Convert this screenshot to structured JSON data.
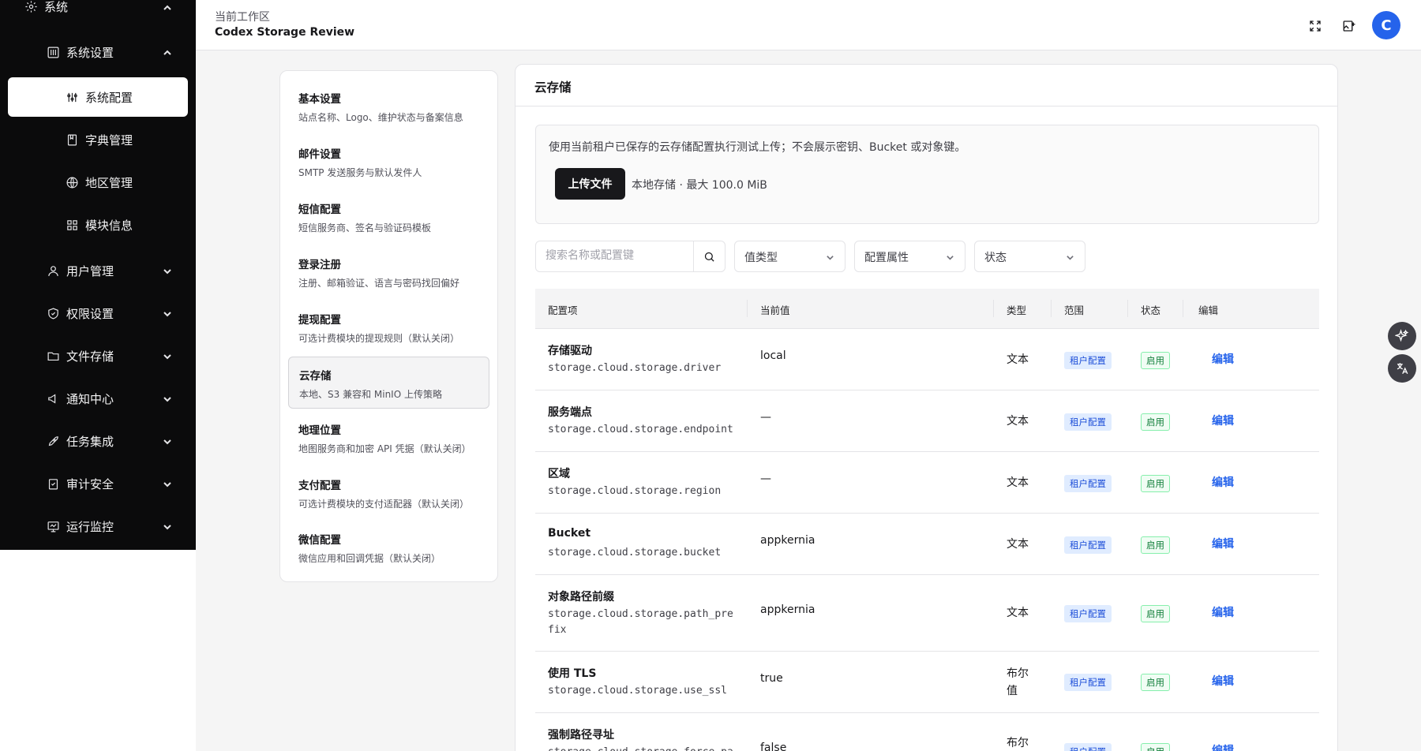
{
  "sidebar": {
    "section_title": "系统",
    "group_title": "系统设置",
    "items": [
      {
        "label": "系统配置"
      },
      {
        "label": "字典管理"
      },
      {
        "label": "地区管理"
      },
      {
        "label": "模块信息"
      }
    ],
    "sections": [
      {
        "label": "用户管理"
      },
      {
        "label": "权限设置"
      },
      {
        "label": "文件存储"
      },
      {
        "label": "通知中心"
      },
      {
        "label": "任务集成"
      },
      {
        "label": "审计安全"
      },
      {
        "label": "运行监控"
      }
    ]
  },
  "header": {
    "workspace_label": "当前工作区",
    "workspace_name": "Codex Storage Review",
    "avatar_letter": "C"
  },
  "settings_nav": [
    {
      "title": "基本设置",
      "desc": "站点名称、Logo、维护状态与备案信息"
    },
    {
      "title": "邮件设置",
      "desc": "SMTP 发送服务与默认发件人"
    },
    {
      "title": "短信配置",
      "desc": "短信服务商、签名与验证码模板"
    },
    {
      "title": "登录注册",
      "desc": "注册、邮箱验证、语言与密码找回偏好"
    },
    {
      "title": "提现配置",
      "desc": "可选计费模块的提现规则（默认关闭）"
    },
    {
      "title": "云存储",
      "desc": "本地、S3 兼容和 MinIO 上传策略"
    },
    {
      "title": "地理位置",
      "desc": "地图服务商和加密 API 凭据（默认关闭）"
    },
    {
      "title": "支付配置",
      "desc": "可选计费模块的支付适配器（默认关闭）"
    },
    {
      "title": "微信配置",
      "desc": "微信应用和回调凭据（默认关闭）"
    }
  ],
  "panel": {
    "title": "云存储",
    "upload_desc": "使用当前租户已保存的云存储配置执行测试上传；不会展示密钥、Bucket 或对象键。",
    "upload_button": "上传文件",
    "upload_info": "本地存储 · 最大 100.0 MiB",
    "search_placeholder": "搜索名称或配置键",
    "filters": {
      "value_type": "值类型",
      "config_attr": "配置属性",
      "status": "状态"
    }
  },
  "table": {
    "headers": {
      "item": "配置项",
      "value": "当前值",
      "type": "类型",
      "scope": "范围",
      "status": "状态",
      "edit": "编辑"
    },
    "rows": [
      {
        "name": "存储驱动",
        "key": "storage.cloud.storage.driver",
        "value": "local",
        "type": "文本",
        "scope": "租户配置",
        "status": "启用",
        "edit": "编辑"
      },
      {
        "name": "服务端点",
        "key": "storage.cloud.storage.endpoint",
        "value": "—",
        "type": "文本",
        "scope": "租户配置",
        "status": "启用",
        "edit": "编辑"
      },
      {
        "name": "区域",
        "key": "storage.cloud.storage.region",
        "value": "—",
        "type": "文本",
        "scope": "租户配置",
        "status": "启用",
        "edit": "编辑"
      },
      {
        "name": "Bucket",
        "key": "storage.cloud.storage.bucket",
        "value": "appkernia",
        "type": "文本",
        "scope": "租户配置",
        "status": "启用",
        "edit": "编辑"
      },
      {
        "name": "对象路径前缀",
        "key": "storage.cloud.storage.path_prefix",
        "value": "appkernia",
        "type": "文本",
        "scope": "租户配置",
        "status": "启用",
        "edit": "编辑"
      },
      {
        "name": "使用 TLS",
        "key": "storage.cloud.storage.use_ssl",
        "value": "true",
        "type": "布尔值",
        "scope": "租户配置",
        "status": "启用",
        "edit": "编辑"
      },
      {
        "name": "强制路径寻址",
        "key": "storage.cloud.storage.force_path_style",
        "value": "false",
        "type": "布尔值",
        "scope": "租户配置",
        "status": "启用",
        "edit": "编辑"
      }
    ]
  }
}
